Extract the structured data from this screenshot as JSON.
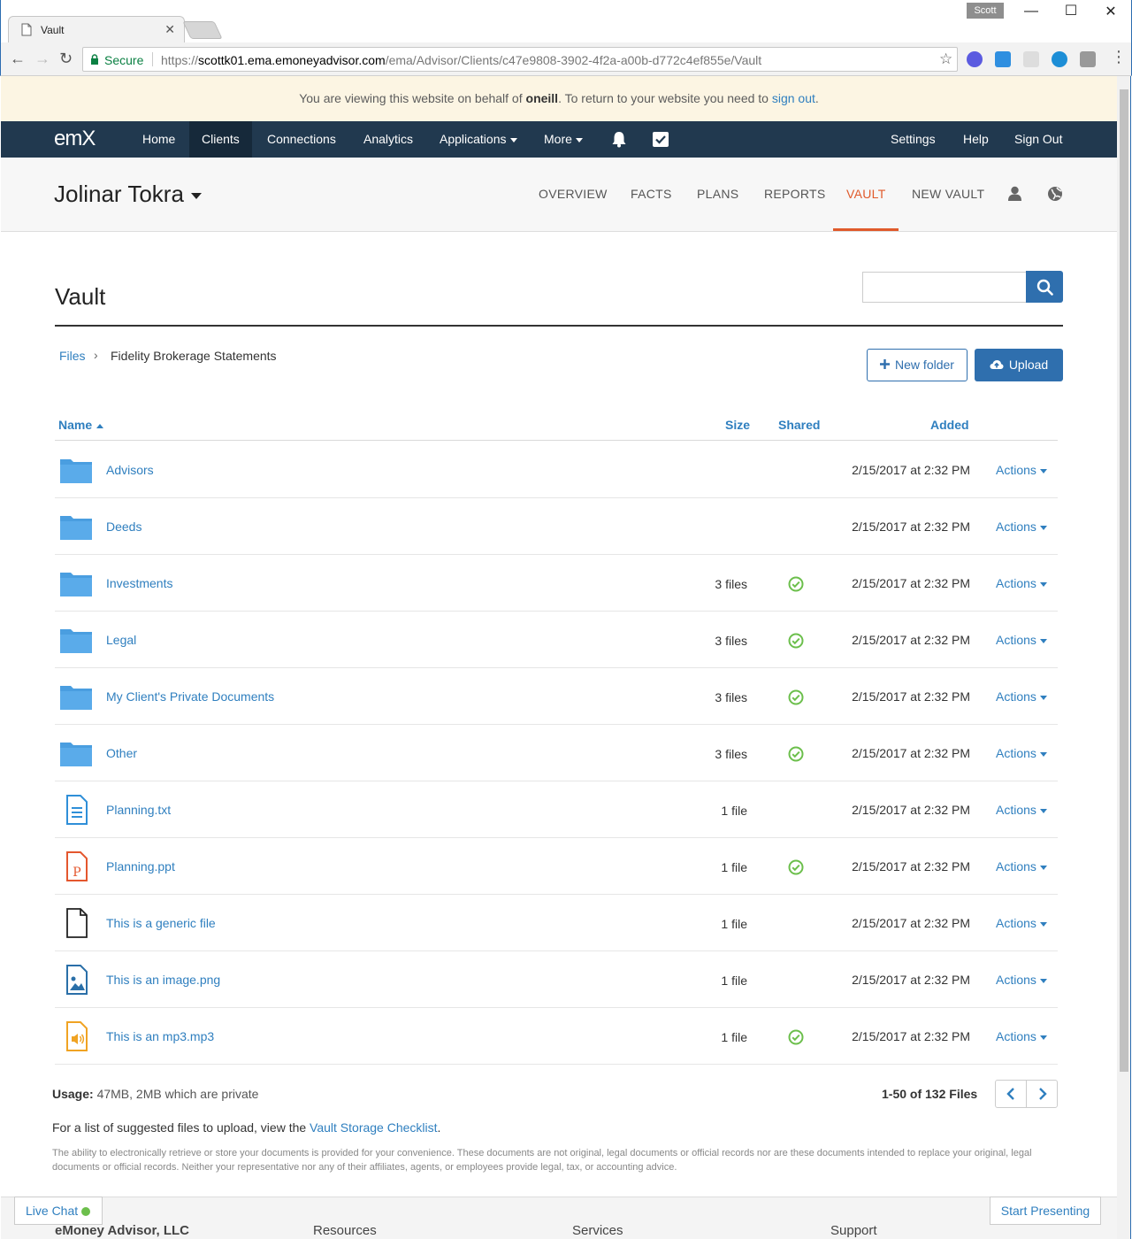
{
  "browser": {
    "tab_title": "Vault",
    "user_badge": "Scott",
    "secure_label": "Secure",
    "url_scheme": "https://",
    "url_host": "scottk01.ema.emoneyadvisor.com",
    "url_path": "/ema/Advisor/Clients/c47e9808-3902-4f2a-a00b-d772c4ef855e/Vault"
  },
  "banner": {
    "prefix": "You are viewing this website on behalf of ",
    "user": "oneill",
    "middle": ".  To return to your website you need to ",
    "link": "sign out",
    "suffix": "."
  },
  "mainnav": {
    "logo": "emX",
    "items": [
      "Home",
      "Clients",
      "Connections",
      "Analytics",
      "Applications",
      "More"
    ],
    "right": [
      "Settings",
      "Help",
      "Sign Out"
    ]
  },
  "client": {
    "name": "Jolinar Tokra",
    "subnav": [
      "OVERVIEW",
      "FACTS",
      "PLANS",
      "REPORTS",
      "VAULT",
      "NEW VAULT"
    ],
    "active_subnav": "VAULT"
  },
  "vault": {
    "title": "Vault",
    "breadcrumb_root": "Files",
    "breadcrumb_current": "Fidelity Brokerage Statements",
    "new_folder_label": "New folder",
    "upload_label": "Upload",
    "columns": {
      "name": "Name",
      "size": "Size",
      "shared": "Shared",
      "added": "Added"
    },
    "rows": [
      {
        "name": "Advisors",
        "type": "folder",
        "size": "",
        "shared": false,
        "added": "2/15/2017 at 2:32 PM",
        "actions": "Actions"
      },
      {
        "name": "Deeds",
        "type": "folder",
        "size": "",
        "shared": false,
        "added": "2/15/2017 at 2:32 PM",
        "actions": "Actions"
      },
      {
        "name": "Investments",
        "type": "folder",
        "size": "3 files",
        "shared": true,
        "added": "2/15/2017 at 2:32 PM",
        "actions": "Actions"
      },
      {
        "name": "Legal",
        "type": "folder",
        "size": "3 files",
        "shared": true,
        "added": "2/15/2017 at 2:32 PM",
        "actions": "Actions"
      },
      {
        "name": "My Client's Private Documents",
        "type": "folder",
        "size": "3 files",
        "shared": true,
        "added": "2/15/2017 at 2:32 PM",
        "actions": "Actions"
      },
      {
        "name": "Other",
        "type": "folder",
        "size": "3 files",
        "shared": true,
        "added": "2/15/2017 at 2:32 PM",
        "actions": "Actions"
      },
      {
        "name": "Planning.txt",
        "type": "txt",
        "size": "1 file",
        "shared": false,
        "added": "2/15/2017 at 2:32 PM",
        "actions": "Actions"
      },
      {
        "name": "Planning.ppt",
        "type": "ppt",
        "size": "1 file",
        "shared": true,
        "added": "2/15/2017 at 2:32 PM",
        "actions": "Actions"
      },
      {
        "name": "This is a generic file",
        "type": "generic",
        "size": "1 file",
        "shared": false,
        "added": "2/15/2017 at 2:32 PM",
        "actions": "Actions"
      },
      {
        "name": "This is an image.png",
        "type": "image",
        "size": "1 file",
        "shared": false,
        "added": "2/15/2017 at 2:32 PM",
        "actions": "Actions"
      },
      {
        "name": "This is an mp3.mp3",
        "type": "audio",
        "size": "1 file",
        "shared": true,
        "added": "2/15/2017 at 2:32 PM",
        "actions": "Actions"
      }
    ],
    "usage_label": "Usage:",
    "usage_value": " 47MB, 2MB which are private",
    "pager_text": "1-50 of 132 Files",
    "suggest_prefix": "For a list of suggested files to upload, view the ",
    "suggest_link": "Vault Storage Checklist",
    "suggest_suffix": ".",
    "disclaimer": "The ability to electronically retrieve or store your documents is provided for your convenience. These documents are not original, legal documents or official records nor are these documents intended to replace your original, legal documents or official records. Neither your representative nor any of their affiliates, agents, or employees provide legal, tax, or accounting advice."
  },
  "footer": {
    "live_chat": "Live Chat",
    "start_presenting": "Start Presenting",
    "columns": [
      "eMoney Advisor, LLC",
      "Resources",
      "Services",
      "Support"
    ]
  },
  "colors": {
    "nav_bg": "#21394f",
    "accent_blue": "#2f7fbf",
    "button_blue": "#2f6fae",
    "active_orange": "#e05a2b",
    "shared_green": "#6cbf4c",
    "banner_bg": "#fcf5e3"
  }
}
